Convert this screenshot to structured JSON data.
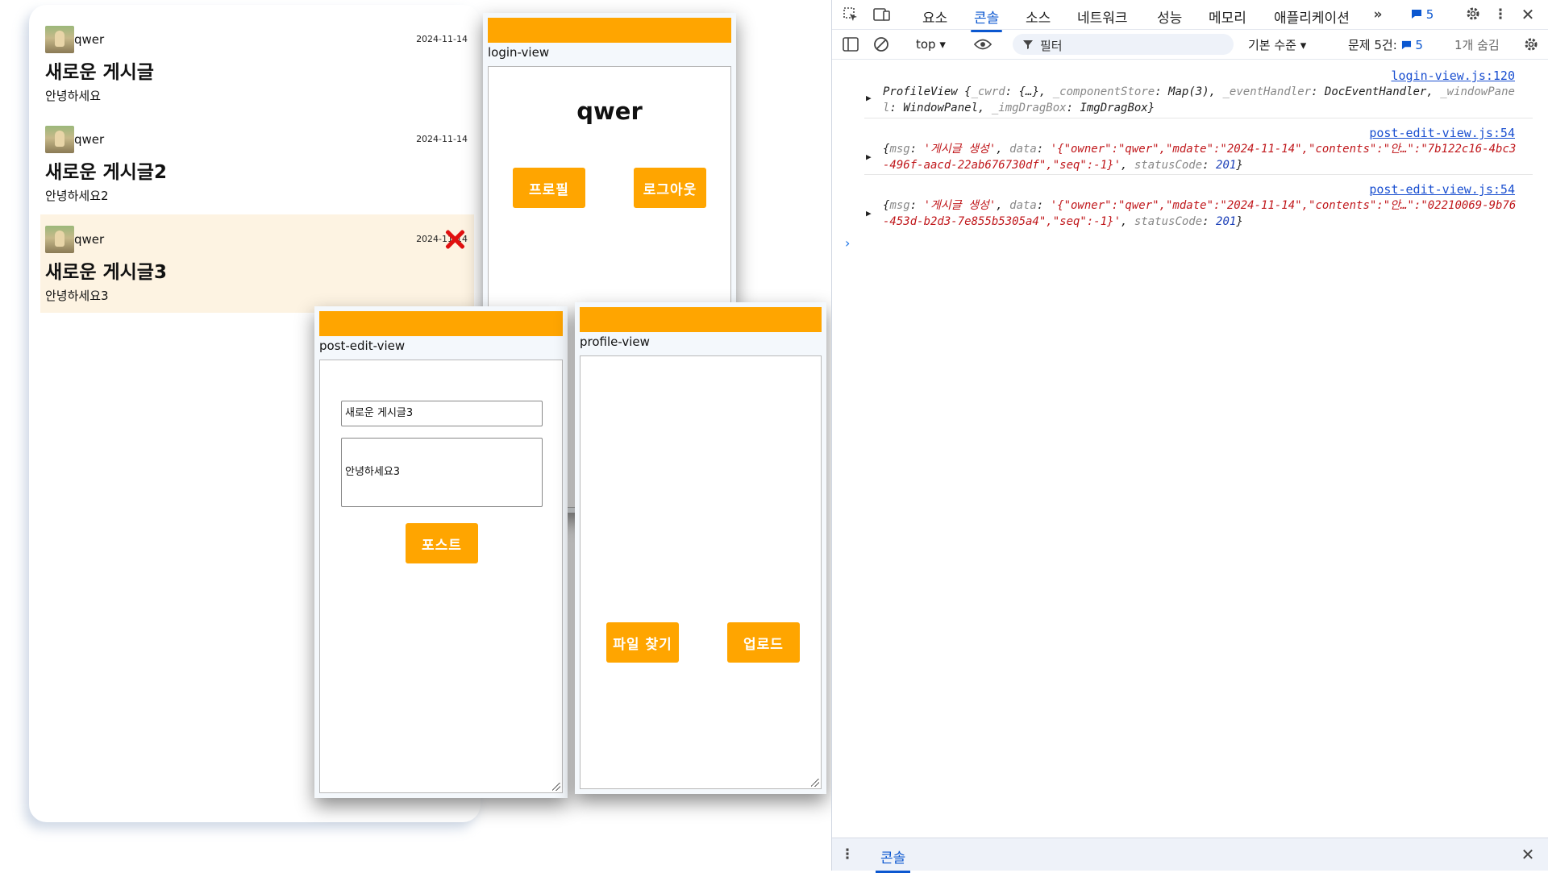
{
  "feed": {
    "posts": [
      {
        "owner": "qwer",
        "date": "2024-11-14",
        "title": "새로운 게시글",
        "body": "안녕하세요"
      },
      {
        "owner": "qwer",
        "date": "2024-11-14",
        "title": "새로운 게시글2",
        "body": "안녕하세요2"
      },
      {
        "owner": "qwer",
        "date": "2024-11-14",
        "title": "새로운 게시글3",
        "body": "안녕하세요3"
      }
    ]
  },
  "login_view": {
    "name": "login-view",
    "username": "qwer",
    "profile_button": "프로필",
    "logout_button": "로그아웃"
  },
  "post_edit_view": {
    "name": "post-edit-view",
    "title_value": "새로운 게시글3",
    "content_value": "안녕하세요3",
    "post_button": "포스트"
  },
  "profile_view": {
    "name": "profile-view",
    "find_file_button": "파일 찾기",
    "upload_button": "업로드"
  },
  "devtools": {
    "tabs": [
      "요소",
      "콘솔",
      "소스",
      "네트워크",
      "성능",
      "메모리",
      "애플리케이션"
    ],
    "active_tab": "콘솔",
    "issues_badge": "5",
    "context": "top",
    "filter_placeholder": "필터",
    "level": "기본 수준",
    "issues_label": "문제 5건:",
    "issues_count": "5",
    "hidden_label": "1개 숨김",
    "logs": [
      {
        "source": "login-view.js:120",
        "parts": [
          [
            "d",
            "ProfileView {"
          ],
          [
            "k",
            "_cwrd"
          ],
          [
            "d",
            ": {…}, "
          ],
          [
            "k",
            "_componentStore"
          ],
          [
            "d",
            ": Map(3), "
          ],
          [
            "k",
            "_eventHandler"
          ],
          [
            "d",
            ": DocEventHandler, "
          ],
          [
            "k",
            "_windowPanel"
          ],
          [
            "d",
            ": WindowPanel, "
          ],
          [
            "k",
            "_imgDragBox"
          ],
          [
            "d",
            ": ImgDragBox}"
          ]
        ]
      },
      {
        "source": "post-edit-view.js:54",
        "parts": [
          [
            "d",
            "{"
          ],
          [
            "k",
            "msg"
          ],
          [
            "d",
            ": "
          ],
          [
            "s",
            "'게시글 생성'"
          ],
          [
            "d",
            ", "
          ],
          [
            "k",
            "data"
          ],
          [
            "d",
            ": "
          ],
          [
            "s",
            "'{\"owner\":\"qwer\",\"mdate\":\"2024-11-14\",\"contents\":\"안…\":\"7b122c16-4bc3-496f-aacd-22ab676730df\",\"seq\":-1}'"
          ],
          [
            "d",
            ", "
          ],
          [
            "k",
            "statusCode"
          ],
          [
            "d",
            ": "
          ],
          [
            "n",
            "201"
          ],
          [
            "d",
            "}"
          ]
        ]
      },
      {
        "source": "post-edit-view.js:54",
        "parts": [
          [
            "d",
            "{"
          ],
          [
            "k",
            "msg"
          ],
          [
            "d",
            ": "
          ],
          [
            "s",
            "'게시글 생성'"
          ],
          [
            "d",
            ", "
          ],
          [
            "k",
            "data"
          ],
          [
            "d",
            ": "
          ],
          [
            "s",
            "'{\"owner\":\"qwer\",\"mdate\":\"2024-11-14\",\"contents\":\"안…\":\"02210069-9b76-453d-b2d3-7e855b5305a4\",\"seq\":-1}'"
          ],
          [
            "d",
            ", "
          ],
          [
            "k",
            "statusCode"
          ],
          [
            "d",
            ": "
          ],
          [
            "n",
            "201"
          ],
          [
            "d",
            "}"
          ]
        ]
      }
    ],
    "drawer_tab": "콘솔"
  }
}
